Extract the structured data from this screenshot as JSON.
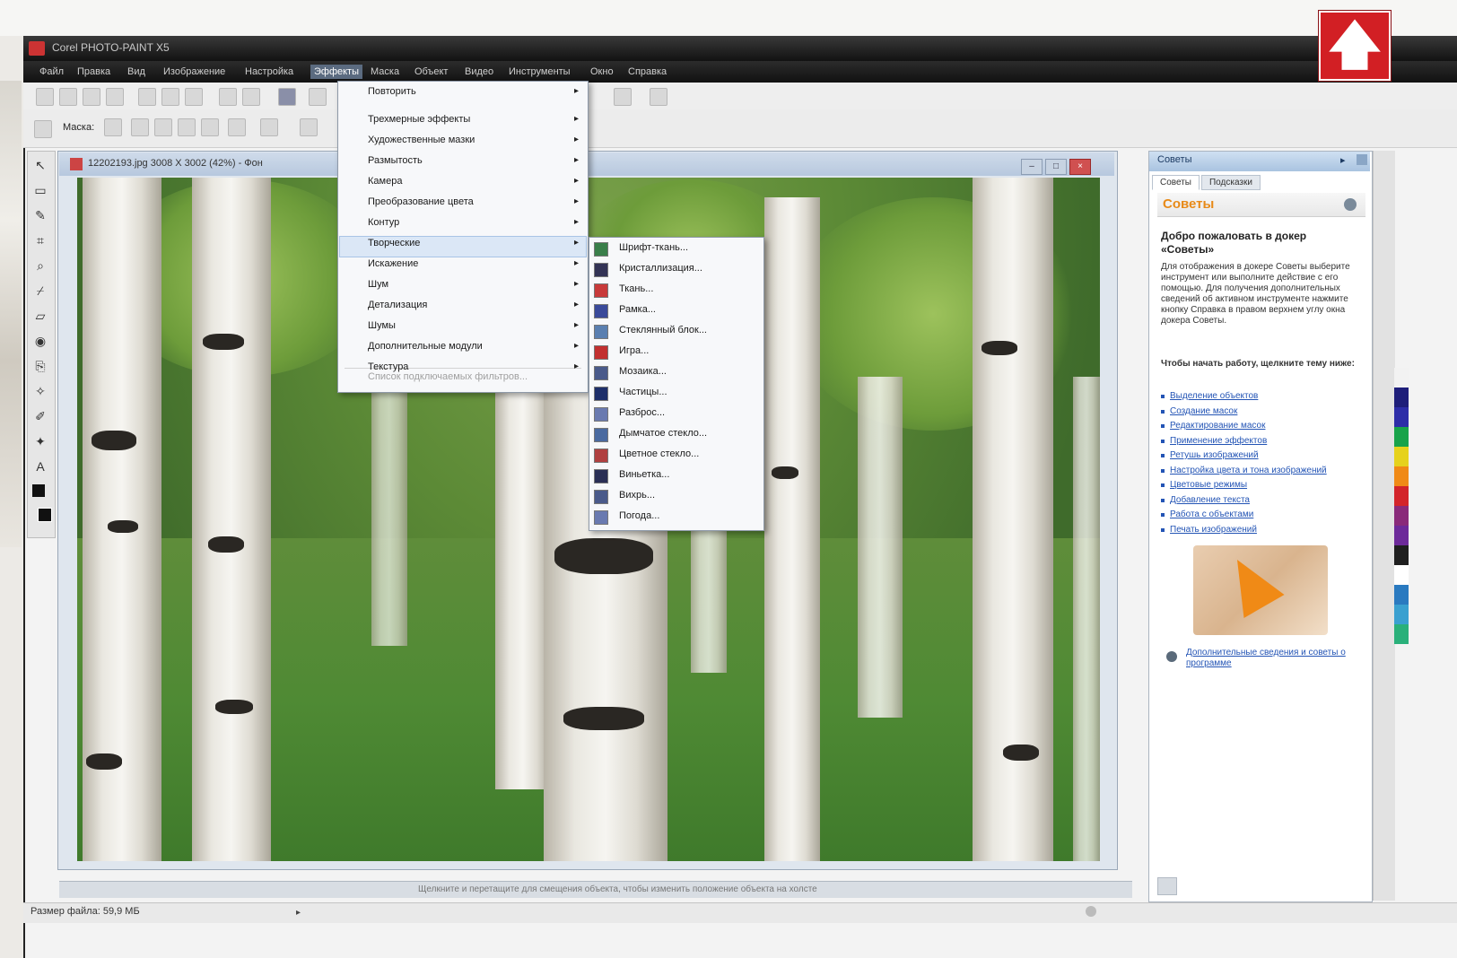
{
  "window": {
    "title": "Corel PHOTO-PAINT X5"
  },
  "menubar": {
    "items": [
      "Файл",
      "Правка",
      "Вид",
      "Изображение",
      "Настройка",
      "Эффекты",
      "Маска",
      "Объект",
      "Видео",
      "Инструменты",
      "Окно",
      "Справка"
    ],
    "active_index": 5
  },
  "property_bar": {
    "mode_label": "Маска:"
  },
  "document": {
    "title": "12202193.jpg 3008 X 3002 (42%) - Фон",
    "status_hint": "Щелкните и перетащите для смещения объекта, чтобы изменить положение объекта на холсте",
    "btn_min": "–",
    "btn_max": "□",
    "btn_close": "×"
  },
  "status_bar": {
    "file_size": "Размер файла: 59,9 МБ"
  },
  "effects_menu": {
    "items": [
      {
        "label": "Повторить",
        "arrow": "▸",
        "disabled": false
      },
      {
        "label": "Трехмерные эффекты",
        "arrow": "▸",
        "disabled": false
      },
      {
        "label": "Художественные мазки",
        "arrow": "▸",
        "disabled": false
      },
      {
        "label": "Размытость",
        "arrow": "▸",
        "disabled": false
      },
      {
        "label": "Камера",
        "arrow": "▸",
        "disabled": false
      },
      {
        "label": "Преобразование цвета",
        "arrow": "▸",
        "disabled": false
      },
      {
        "label": "Контур",
        "arrow": "▸",
        "disabled": false
      },
      {
        "label": "Творческие",
        "arrow": "▸",
        "disabled": false
      },
      {
        "label": "Искажение",
        "arrow": "▸",
        "disabled": false
      },
      {
        "label": "Шум",
        "arrow": "▸",
        "disabled": false
      },
      {
        "label": "Детализация",
        "arrow": "▸",
        "disabled": false
      },
      {
        "label": "Шумы",
        "arrow": "▸",
        "disabled": false
      },
      {
        "label": "Дополнительные модули",
        "arrow": "▸",
        "disabled": false
      },
      {
        "label": "Текстура",
        "arrow": "▸",
        "disabled": false
      },
      {
        "label": "Список подключаемых фильтров...",
        "arrow": "",
        "disabled": true
      }
    ],
    "highlighted_index": 7
  },
  "creative_submenu": {
    "items": [
      {
        "label": "Шрифт-ткань...",
        "icon": "crafts-icon",
        "color": "#3a7f4a"
      },
      {
        "label": "Кристаллизация...",
        "icon": "crystallize-icon",
        "color": "#333355"
      },
      {
        "label": "Ткань...",
        "icon": "fabric-icon",
        "color": "#c83a3a"
      },
      {
        "label": "Рамка...",
        "icon": "frame-icon",
        "color": "#3a4a9a"
      },
      {
        "label": "Стеклянный блок...",
        "icon": "glass-block-icon",
        "color": "#5a7fb0"
      },
      {
        "label": "Игра...",
        "icon": "kids-play-icon",
        "color": "#c23030"
      },
      {
        "label": "Мозаика...",
        "icon": "mosaic-icon",
        "color": "#4a5a8a"
      },
      {
        "label": "Частицы...",
        "icon": "particles-icon",
        "color": "#1e2f6a"
      },
      {
        "label": "Разброс...",
        "icon": "scatter-icon",
        "color": "#6a7ab0"
      },
      {
        "label": "Дымчатое стекло...",
        "icon": "smoked-glass-icon",
        "color": "#4a6aa0"
      },
      {
        "label": "Цветное стекло...",
        "icon": "stained-glass-icon",
        "color": "#b04040"
      },
      {
        "label": "Виньетка...",
        "icon": "vignette-icon",
        "color": "#2a2f55"
      },
      {
        "label": "Вихрь...",
        "icon": "vortex-icon",
        "color": "#4a5a8a"
      },
      {
        "label": "Погода...",
        "icon": "weather-icon",
        "color": "#6a7ab0"
      }
    ]
  },
  "docker": {
    "header": "Советы",
    "tabs": [
      "Советы",
      "Подсказки"
    ],
    "hints_title": "Советы",
    "heading": "Добро пожаловать в докер «Советы»",
    "paragraph": "Для отображения в докере Советы выберите инструмент или выполните действие с его помощью. Для получения дополнительных сведений об активном инструменте нажмите кнопку Справка в правом верхнем углу окна докера Советы.",
    "section_label": "Чтобы начать работу, щелкните тему ниже:",
    "links": [
      "Выделение объектов",
      "Создание масок",
      "Редактирование масок",
      "Применение эффектов",
      "Ретушь изображений",
      "Настройка цвета и тона изображений",
      "Цветовые режимы",
      "Добавление текста",
      "Работа с объектами",
      "Печать изображений"
    ],
    "bottom_link": "Дополнительные сведения и советы о программе"
  },
  "palette": [
    "#f2f2f2",
    "#1e1e7a",
    "#2d2da8",
    "#18a34a",
    "#e6d21c",
    "#f08a16",
    "#d3242a",
    "#8a2a7a",
    "#6d2a9a",
    "#1f1f1f",
    "#ffffff",
    "#2a7ac0",
    "#3aa0d0",
    "#2ab07a"
  ],
  "colors": {
    "titlebar": "#121212",
    "accent_orange": "#e88a18",
    "link_blue": "#2354b5",
    "badge_red": "#d21f24"
  },
  "badge": {
    "icon": "up-arrow-icon",
    "glyph": "🡅"
  }
}
